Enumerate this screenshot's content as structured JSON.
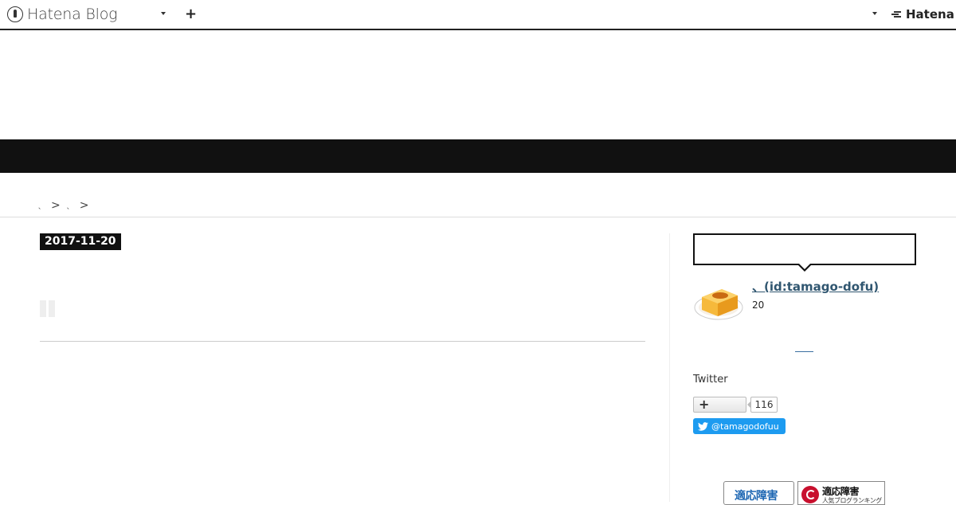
{
  "navbar": {
    "brand": "Hatena Blog",
    "add_label": "+",
    "hatena_label": "Hatena"
  },
  "breadcrumb": {
    "items": [
      "、",
      "、"
    ],
    "separator": ">"
  },
  "entry": {
    "date": "2017-11-20"
  },
  "sidebar": {
    "profile": {
      "name": "、(id:tamago-dofu)",
      "count": "20"
    },
    "twitter": {
      "label": "Twitter",
      "bookmark_plus": "+",
      "bookmark_count": "116",
      "follow_label": "@tamagodofuu"
    },
    "ranking": {
      "banner1_text": "適応障害",
      "banner2_title": "適応障害",
      "banner2_sub": "人気ブログランキング"
    }
  },
  "colors": {
    "accent_dark": "#111111",
    "profile_link": "#305670",
    "twitter_blue": "#1d9bf0",
    "ranking_red": "#c8102e",
    "ranking_blue": "#1e67b3"
  }
}
